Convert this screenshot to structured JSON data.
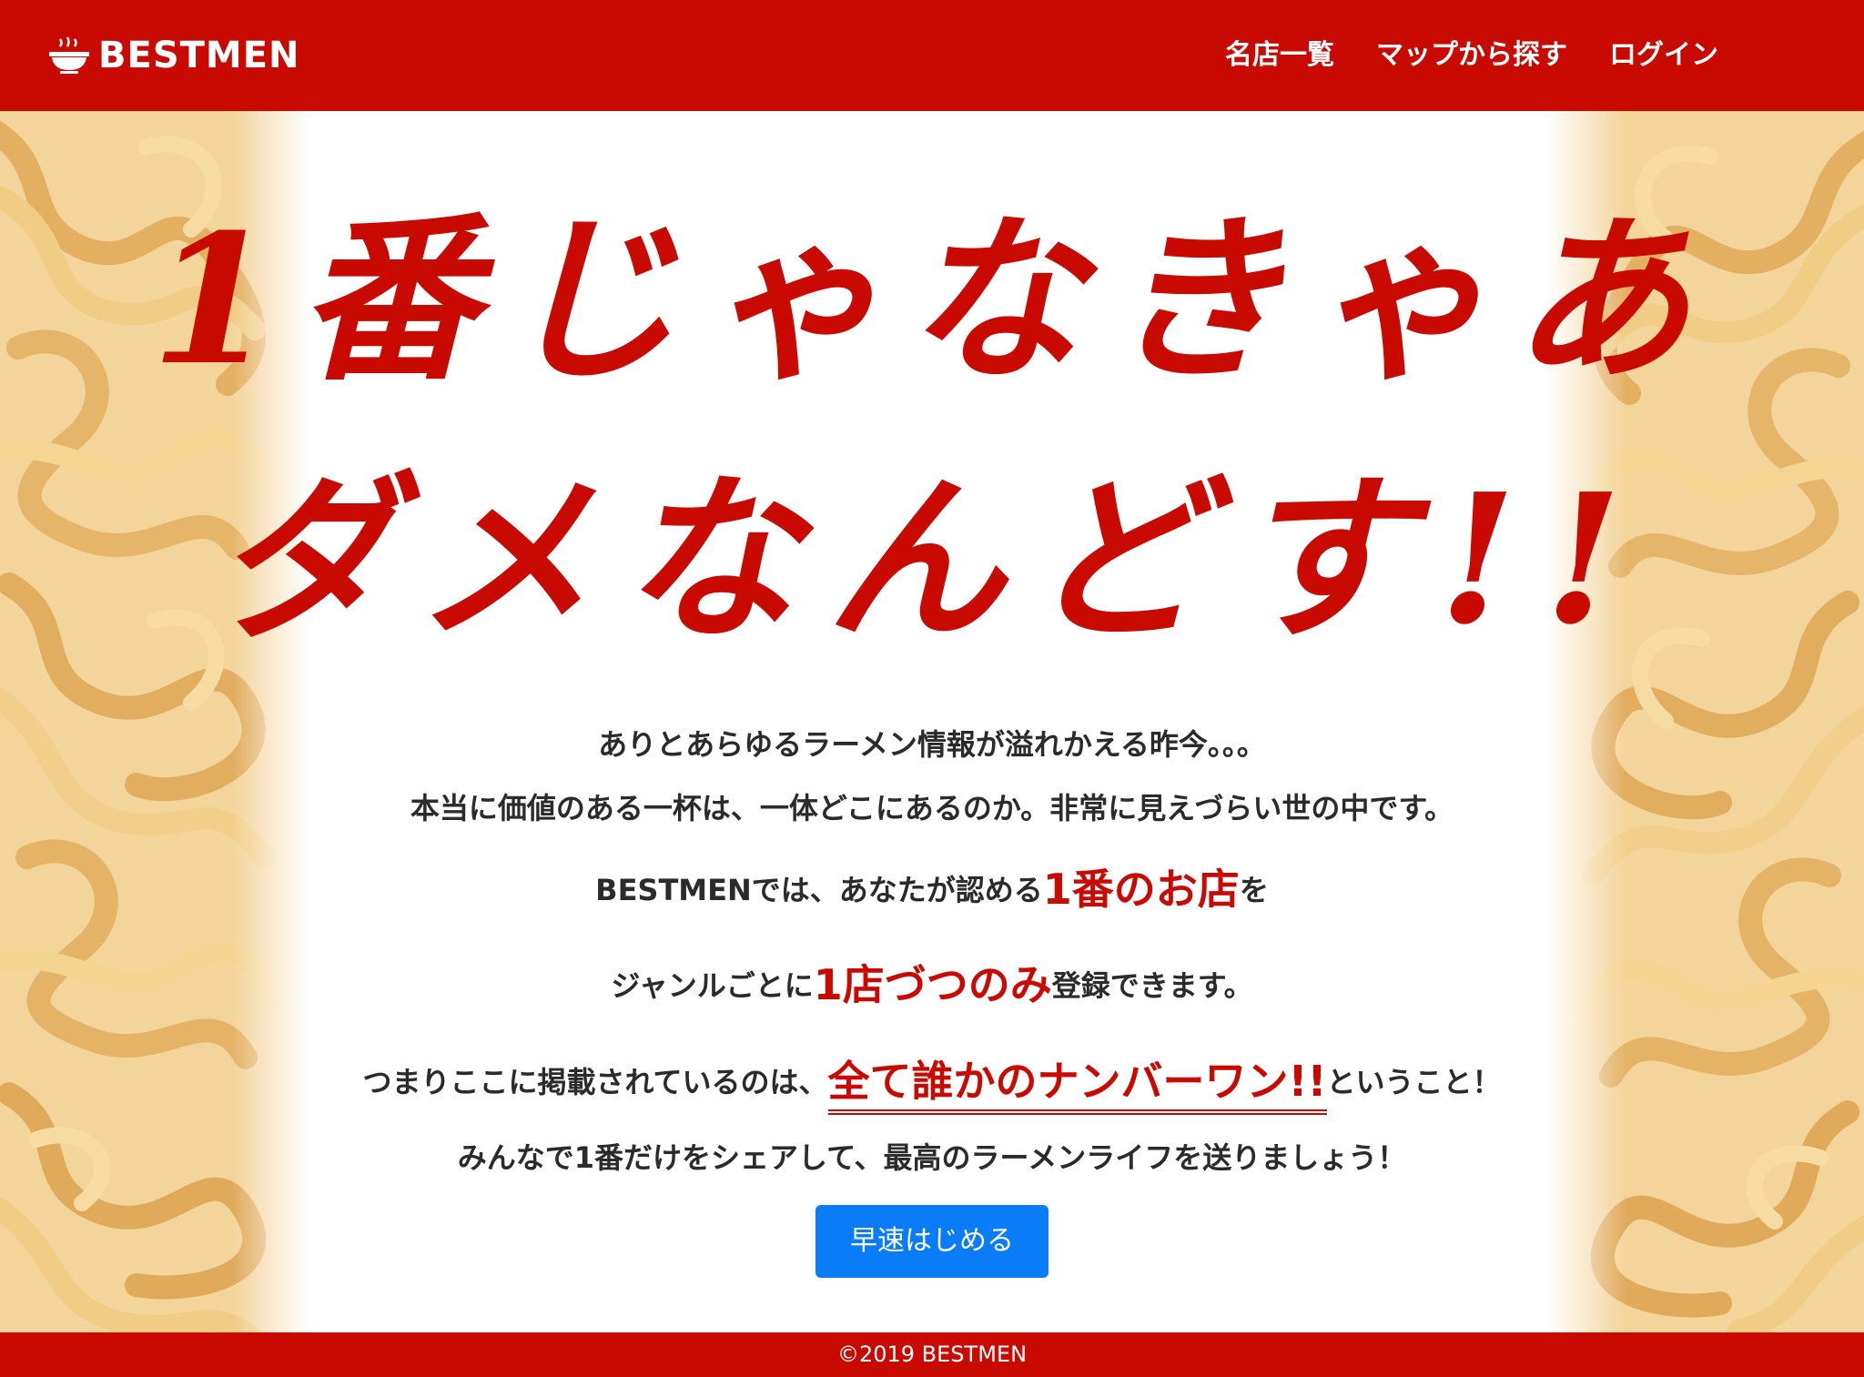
{
  "header": {
    "brand": "BESTMEN",
    "nav": [
      "名店一覧",
      "マップから探す",
      "ログイン"
    ]
  },
  "hero": {
    "headline_line1": "1番じゃなきゃあ",
    "headline_line2": "ダメなんどす!!",
    "paragraphs": {
      "p1": "ありとあらゆるラーメン情報が溢れかえる昨今。。。",
      "p2": "本当に価値のある一杯は、一体どこにあるのか。非常に見えづらい世の中です。",
      "p3_pre": "BESTMENでは、あなたが認める",
      "p3_accent": "1番のお店",
      "p3_post": "を",
      "p4_pre": "ジャンルごとに",
      "p4_accent": "1店づつのみ",
      "p4_post": "登録できます。",
      "p5_pre": "つまりここに掲載されているのは、",
      "p5_accent": "全て誰かのナンバーワン!!",
      "p5_post": "ということ！",
      "p6": "みんなで1番だけをシェアして、最高のラーメンライフを送りましょう！"
    },
    "cta": "早速はじめる"
  },
  "footer": {
    "copyright": "©2019 BESTMEN"
  },
  "colors": {
    "brand_red": "#c90a02",
    "cta_blue": "#0a7cf7",
    "noodle": "#e9bd72"
  },
  "icons": {
    "brand": "ramen-bowl-icon"
  }
}
